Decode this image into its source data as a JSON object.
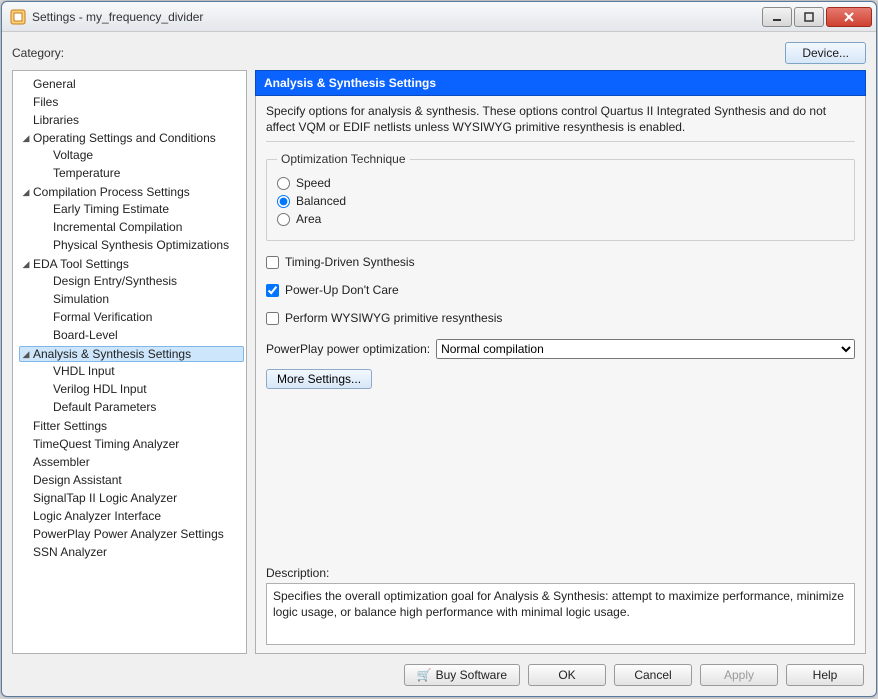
{
  "window": {
    "title": "Settings - my_frequency_divider"
  },
  "top": {
    "category_label": "Category:",
    "device_button": "Device..."
  },
  "tree": {
    "general": "General",
    "files": "Files",
    "libraries": "Libraries",
    "op_settings": "Operating Settings and Conditions",
    "voltage": "Voltage",
    "temperature": "Temperature",
    "compilation": "Compilation Process Settings",
    "early_timing": "Early Timing Estimate",
    "incremental": "Incremental Compilation",
    "phys_synth": "Physical Synthesis Optimizations",
    "eda": "EDA Tool Settings",
    "design_entry": "Design Entry/Synthesis",
    "simulation": "Simulation",
    "formal": "Formal Verification",
    "board": "Board-Level",
    "ans": "Analysis & Synthesis Settings",
    "vhdl": "VHDL Input",
    "verilog": "Verilog HDL Input",
    "def_params": "Default Parameters",
    "fitter": "Fitter Settings",
    "timequest": "TimeQuest Timing Analyzer",
    "assembler": "Assembler",
    "design_assistant": "Design Assistant",
    "signaltap": "SignalTap II Logic Analyzer",
    "logic_if": "Logic Analyzer Interface",
    "powerplay": "PowerPlay Power Analyzer Settings",
    "ssn": "SSN Analyzer"
  },
  "panel": {
    "heading": "Analysis & Synthesis Settings",
    "description_text": "Specify options for analysis & synthesis. These options control Quartus II Integrated Synthesis and do not affect VQM or EDIF netlists unless WYSIWYG primitive resynthesis is enabled.",
    "opt_tech_legend": "Optimization Technique",
    "opt_speed": "Speed",
    "opt_balanced": "Balanced",
    "opt_area": "Area",
    "chk_timing": "Timing-Driven Synthesis",
    "chk_powerup": "Power-Up Don't Care",
    "chk_wysiwyg": "Perform WYSIWYG primitive resynthesis",
    "power_label": "PowerPlay power optimization:",
    "power_value": "Normal compilation",
    "more_settings": "More Settings...",
    "desc_label": "Description:",
    "desc_body": "Specifies the overall optimization goal for Analysis & Synthesis: attempt to maximize performance, minimize logic usage, or balance high performance with minimal logic usage."
  },
  "footer": {
    "buy": "Buy Software",
    "ok": "OK",
    "cancel": "Cancel",
    "apply": "Apply",
    "help": "Help"
  }
}
